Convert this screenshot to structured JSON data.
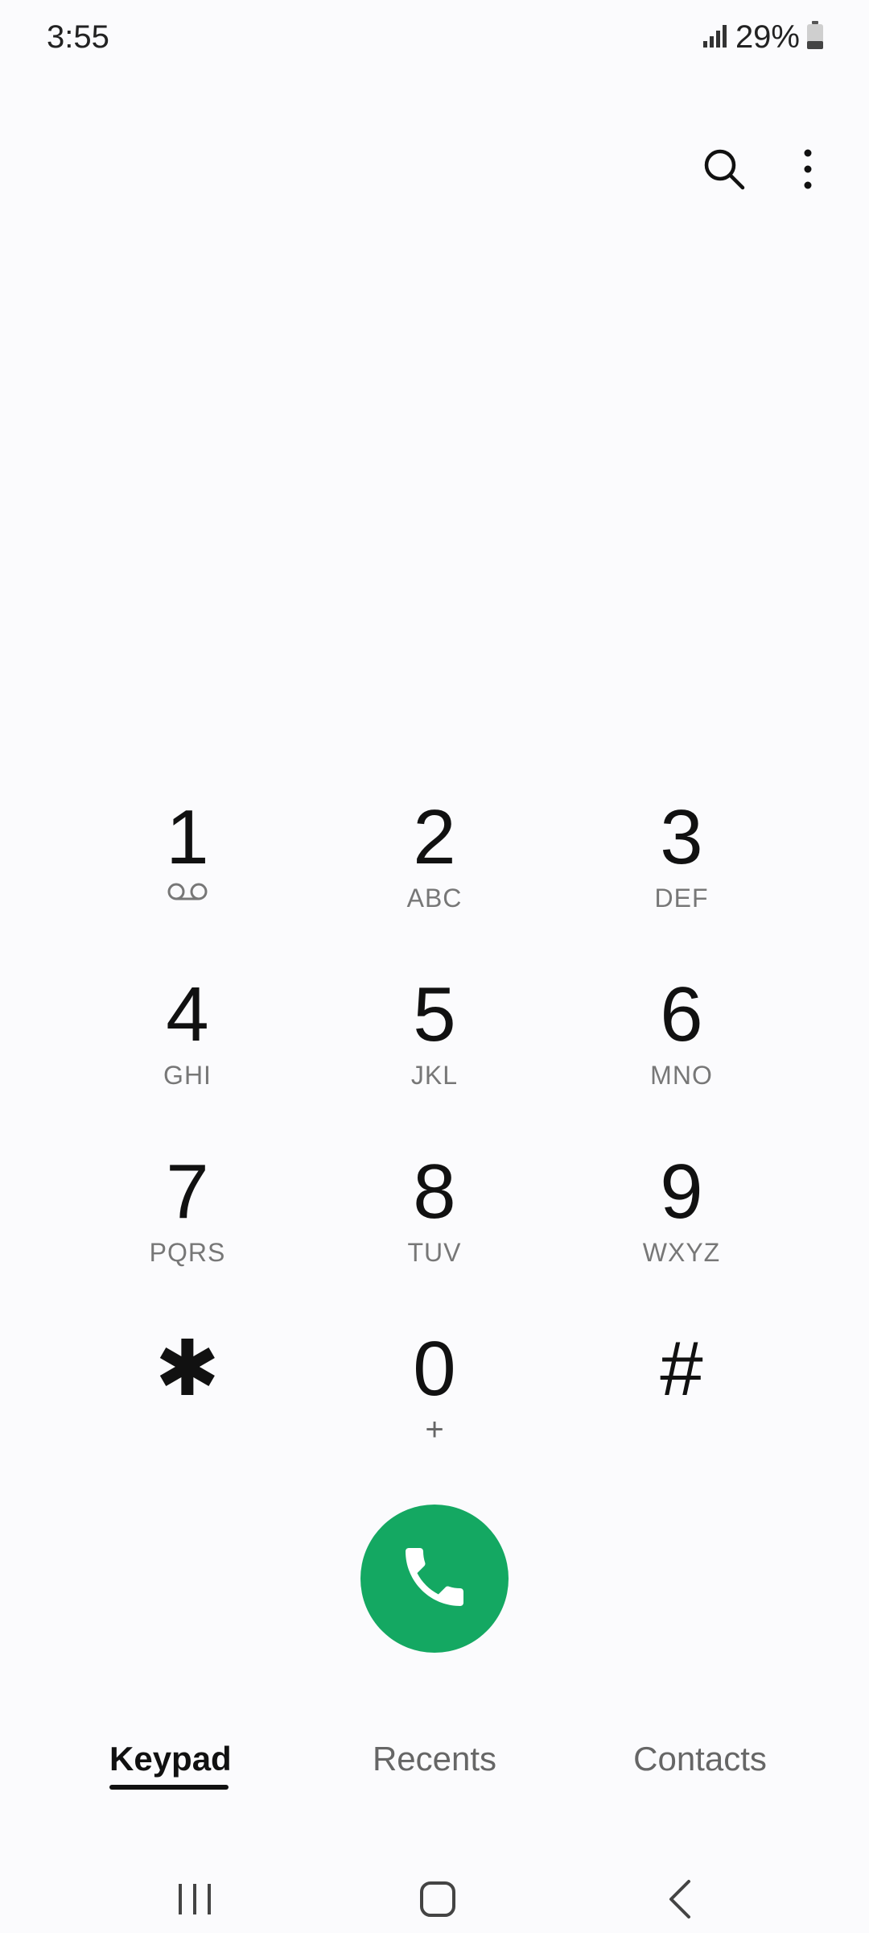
{
  "status_bar": {
    "time": "3:55",
    "battery_percent_text": "29%",
    "battery_level": 0.29
  },
  "top_actions": {
    "search_icon": "search-icon",
    "more_icon": "more-vertical-icon"
  },
  "keypad": {
    "rows": [
      [
        {
          "digit": "1",
          "sub": "",
          "sub_icon": "voicemail-icon"
        },
        {
          "digit": "2",
          "sub": "ABC"
        },
        {
          "digit": "3",
          "sub": "DEF"
        }
      ],
      [
        {
          "digit": "4",
          "sub": "GHI"
        },
        {
          "digit": "5",
          "sub": "JKL"
        },
        {
          "digit": "6",
          "sub": "MNO"
        }
      ],
      [
        {
          "digit": "7",
          "sub": "PQRS"
        },
        {
          "digit": "8",
          "sub": "TUV"
        },
        {
          "digit": "9",
          "sub": "WXYZ"
        }
      ],
      [
        {
          "digit": "✱",
          "sub": ""
        },
        {
          "digit": "0",
          "sub": "+"
        },
        {
          "digit": "#",
          "sub": ""
        }
      ]
    ]
  },
  "call_button": {
    "icon": "phone-icon",
    "color": "#14a862"
  },
  "tabs": [
    {
      "label": "Keypad",
      "active": true
    },
    {
      "label": "Recents",
      "active": false
    },
    {
      "label": "Contacts",
      "active": false
    }
  ],
  "nav_bar": {
    "recents_icon": "recent-apps-icon",
    "home_icon": "home-icon",
    "back_icon": "back-icon"
  }
}
